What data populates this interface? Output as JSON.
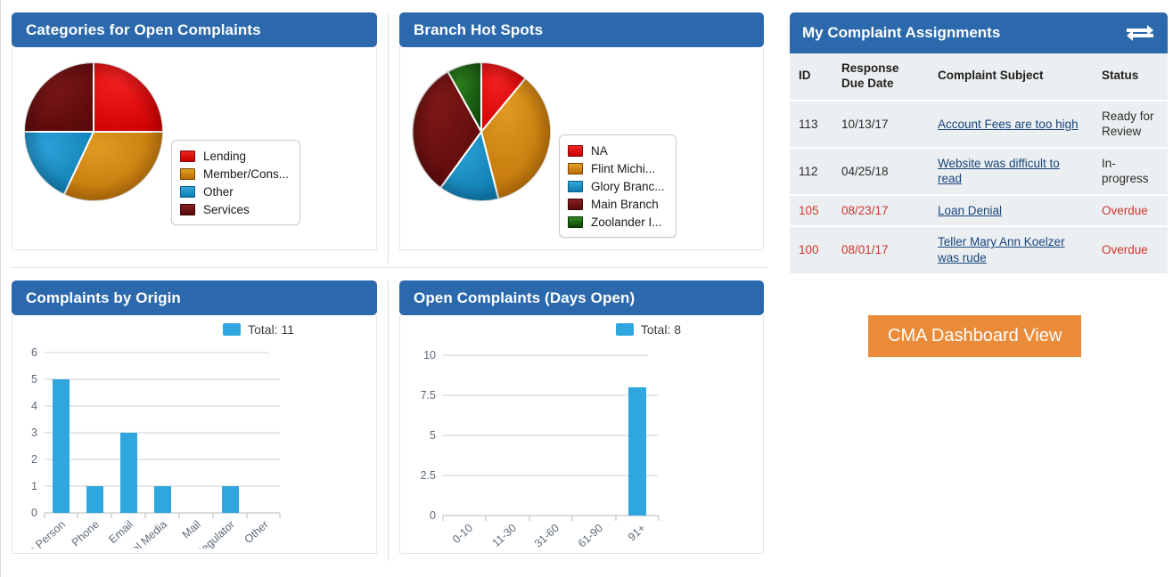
{
  "panels": {
    "categories": {
      "title": "Categories for Open Complaints"
    },
    "branch": {
      "title": "Branch Hot Spots"
    },
    "origin": {
      "title": "Complaints by Origin"
    },
    "daysopen": {
      "title": "Open Complaints (Days Open)"
    },
    "assignments": {
      "title": "My Complaint Assignments",
      "swap_icon": "swap-arrows-icon"
    }
  },
  "assignments_table": {
    "columns": [
      "ID",
      "Response Due Date",
      "Complaint Subject",
      "Status"
    ],
    "rows": [
      {
        "id": "113",
        "due": "10/13/17",
        "subject": "Account Fees are too high",
        "status": "Ready for Review",
        "overdue": false
      },
      {
        "id": "112",
        "due": "04/25/18",
        "subject": "Website was difficult to read",
        "status": "In-progress",
        "overdue": false
      },
      {
        "id": "105",
        "due": "08/23/17",
        "subject": "Loan Denial",
        "status": "Overdue",
        "overdue": true
      },
      {
        "id": "100",
        "due": "08/01/17",
        "subject": "Teller Mary Ann Koelzer was rude",
        "status": "Overdue",
        "overdue": true
      }
    ]
  },
  "cma_button": {
    "label": "CMA Dashboard View",
    "color": "#e98b38"
  },
  "colors": {
    "header_blue": "#2b69ac",
    "bar_blue": "#2fa6de",
    "red": "#e00b0b",
    "orange": "#d4860d",
    "blue": "#1a8ec4",
    "dark_red": "#6e1010",
    "green": "#1d6312",
    "overdue_red": "#d0342c",
    "link_blue": "#17457c"
  },
  "chart_data": [
    {
      "type": "pie",
      "title": "Categories for Open Complaints",
      "legend_position": "right",
      "labels": [
        "Lending",
        "Member/Cons...",
        "Other",
        "Services"
      ],
      "values": [
        25,
        32,
        18,
        25
      ],
      "colors": [
        "#e00b0b",
        "#d4860d",
        "#1a8ec4",
        "#6e1010"
      ]
    },
    {
      "type": "pie",
      "title": "Branch Hot Spots",
      "legend_position": "right",
      "labels": [
        "NA",
        "Flint Michi...",
        "Glory Branc...",
        "Main Branch",
        "Zoolander I..."
      ],
      "values": [
        14,
        32,
        14,
        32,
        8
      ],
      "colors": [
        "#e00b0b",
        "#d4860d",
        "#1a8ec4",
        "#6e1010",
        "#1d6312"
      ]
    },
    {
      "type": "bar",
      "title": "Complaints by Origin",
      "categories": [
        "In Person",
        "Phone",
        "Email",
        "Social Media",
        "Mail",
        "Regulator",
        "Other"
      ],
      "values": [
        5,
        1,
        3,
        1,
        0,
        1,
        0
      ],
      "legend": "Total: 11",
      "xlabel": "",
      "ylabel": "",
      "ylim": [
        0,
        6
      ],
      "yticks": [
        0,
        1,
        2,
        3,
        4,
        5,
        6
      ],
      "grid": true,
      "bar_color": "#2fa6de"
    },
    {
      "type": "bar",
      "title": "Open Complaints (Days Open)",
      "categories": [
        "0-10",
        "11-30",
        "31-60",
        "61-90",
        "91+"
      ],
      "values": [
        0,
        0,
        0,
        0,
        8
      ],
      "legend": "Total: 8",
      "xlabel": "",
      "ylabel": "",
      "ylim": [
        0,
        10
      ],
      "yticks": [
        0,
        2.5,
        5,
        7.5,
        10
      ],
      "grid": true,
      "bar_color": "#2fa6de"
    }
  ]
}
